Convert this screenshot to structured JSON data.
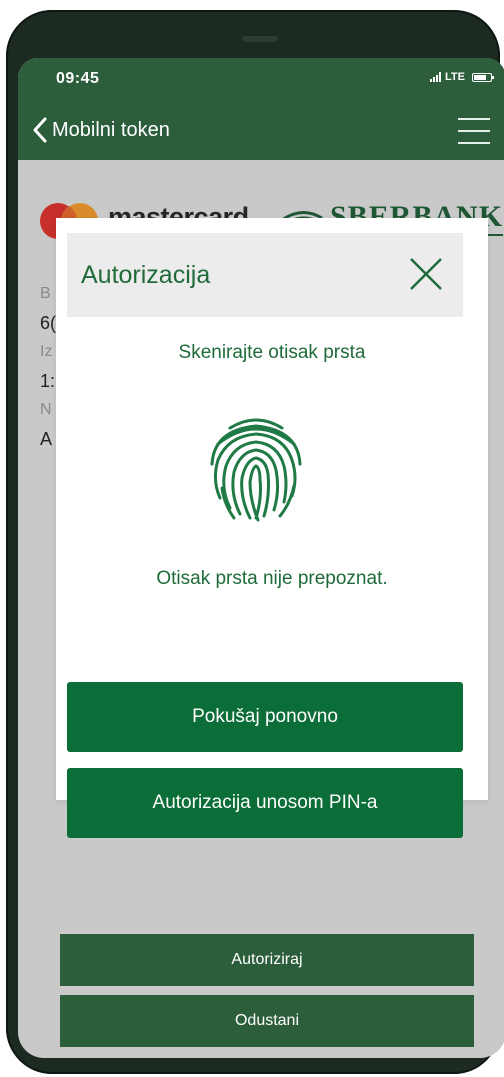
{
  "status_bar": {
    "time": "09:45",
    "network": "LTE"
  },
  "nav": {
    "back_label": "Mobilni token"
  },
  "brands": {
    "mastercard": "mastercard",
    "bank": "SBERBANK"
  },
  "info_rows": [
    {
      "label": "B",
      "value": "6("
    },
    {
      "label": "Iz",
      "value": "1:"
    },
    {
      "label": "N",
      "value": "A"
    }
  ],
  "footer": {
    "authorize_label": "Autoriziraj",
    "cancel_label": "Odustani"
  },
  "modal": {
    "title": "Autorizacija",
    "prompt": "Skenirajte otisak prsta",
    "error": "Otisak prsta nije prepoznat.",
    "retry_label": "Pokušaj ponovno",
    "pin_label": "Autorizacija unosom PIN-a"
  },
  "icons": {
    "back": "chevron-left-icon",
    "menu": "hamburger-menu-icon",
    "close": "close-icon",
    "fingerprint": "fingerprint-icon"
  },
  "colors": {
    "header_green": "#2c5e3c",
    "button_green": "#0b6d37",
    "text_green": "#1f6b39",
    "overlay_gray": "#c9c9c9"
  }
}
